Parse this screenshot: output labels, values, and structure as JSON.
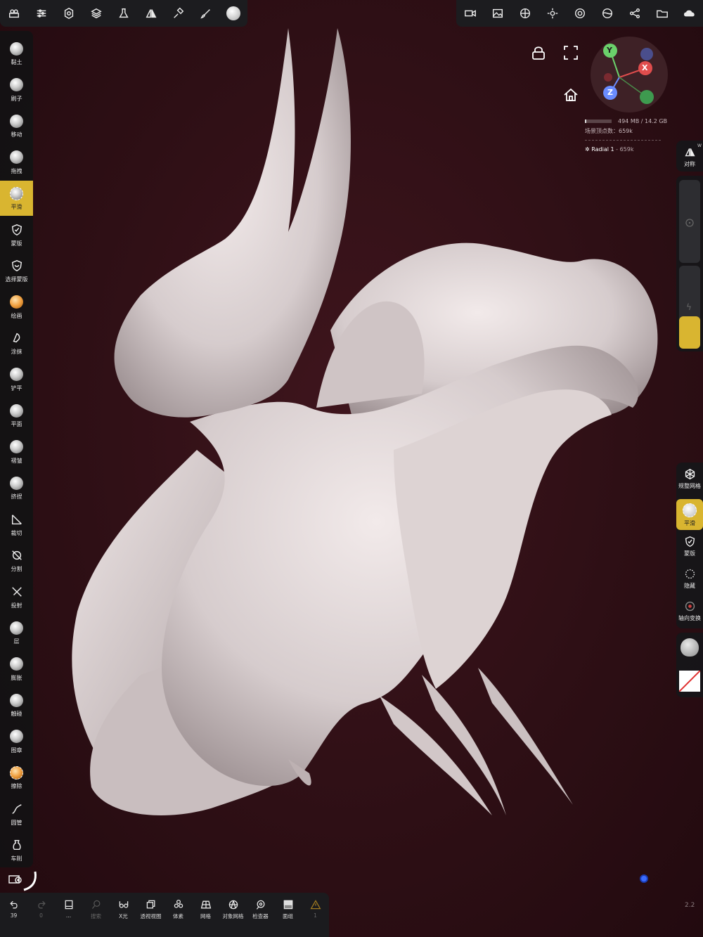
{
  "top_left_toolbar": {
    "icons": [
      "scene-icon",
      "settings-sliders-icon",
      "gear-icon",
      "layers-icon",
      "flask-icon",
      "symmetry-icon",
      "hammer-icon",
      "brush-icon",
      "smooth-tool-icon"
    ]
  },
  "top_right_toolbar": {
    "icons": [
      "camera-icon",
      "image-icon",
      "material-icon",
      "light-icon",
      "shading-icon",
      "env-icon",
      "share-icon",
      "folder-icon",
      "cloud-icon"
    ]
  },
  "left_tools": [
    {
      "label": "黏土",
      "icon": "clay-sphere-icon"
    },
    {
      "label": "刷子",
      "icon": "brush-sphere-icon"
    },
    {
      "label": "移动",
      "icon": "move-sphere-icon"
    },
    {
      "label": "拖拽",
      "icon": "drag-sphere-icon"
    },
    {
      "label": "平滑",
      "icon": "smooth-icon",
      "active": true
    },
    {
      "label": "蒙版",
      "icon": "mask-icon"
    },
    {
      "label": "选择蒙版",
      "icon": "select-mask-icon"
    },
    {
      "label": "绘画",
      "icon": "paint-sphere-icon"
    },
    {
      "label": "涂抹",
      "icon": "smudge-icon"
    },
    {
      "label": "铲平",
      "icon": "flatten-sphere-icon"
    },
    {
      "label": "平面",
      "icon": "planar-sphere-icon"
    },
    {
      "label": "褶皱",
      "icon": "crease-sphere-icon"
    },
    {
      "label": "挤捏",
      "icon": "pinch-sphere-icon"
    },
    {
      "label": "裁切",
      "icon": "trim-icon"
    },
    {
      "label": "分割",
      "icon": "split-icon"
    },
    {
      "label": "投射",
      "icon": "project-icon"
    },
    {
      "label": "层",
      "icon": "layer-sphere-icon"
    },
    {
      "label": "膨胀",
      "icon": "inflate-sphere-icon"
    },
    {
      "label": "触碰",
      "icon": "tube-sphere-icon"
    },
    {
      "label": "图章",
      "icon": "stamp-sphere-icon"
    },
    {
      "label": "擦除",
      "icon": "erase-sphere-icon"
    },
    {
      "label": "圆管",
      "icon": "tube-curve-icon"
    },
    {
      "label": "车削",
      "icon": "lathe-icon"
    }
  ],
  "bottom_bar": [
    {
      "label": "39",
      "icon": "undo-icon",
      "dim": false
    },
    {
      "label": "0",
      "icon": "redo-icon",
      "dim": true
    },
    {
      "label": "...",
      "icon": "doc-icon",
      "dim": false
    },
    {
      "label": "搜索",
      "icon": "search-icon",
      "dim": true
    },
    {
      "label": "X光",
      "icon": "xray-icon",
      "dim": false
    },
    {
      "label": "透视视图",
      "icon": "perspective-icon",
      "dim": false
    },
    {
      "label": "体素",
      "icon": "voxel-icon",
      "dim": false
    },
    {
      "label": "网格",
      "icon": "mesh-icon",
      "dim": false
    },
    {
      "label": "对象网格",
      "icon": "object-mesh-icon",
      "dim": false
    },
    {
      "label": "检查器",
      "icon": "inspector-icon",
      "dim": false
    },
    {
      "label": "面组",
      "icon": "facegroup-icon",
      "dim": false
    },
    {
      "label": "1",
      "icon": "warning-icon",
      "dim": true
    }
  ],
  "stats": {
    "memory": "494 MB / 14.2 GB",
    "vertices": "场景顶点数：659k",
    "radial_name": "Radial 1",
    "radial_count": " - 659k"
  },
  "gizmo": {
    "x": "X",
    "y": "Y",
    "z": "Z"
  },
  "right_panel": {
    "symmetry_label": "对称",
    "symmetry_badge": "W",
    "remesh_label": "规整网格",
    "smooth_label": "平滑",
    "mask_label": "蒙版",
    "hide_label": "隐藏",
    "transform_label": "轴向变换"
  },
  "version": "2.2",
  "colors": {
    "accent": "#d9b530",
    "background": "#2e0f15",
    "model": "#d8cfcf"
  }
}
